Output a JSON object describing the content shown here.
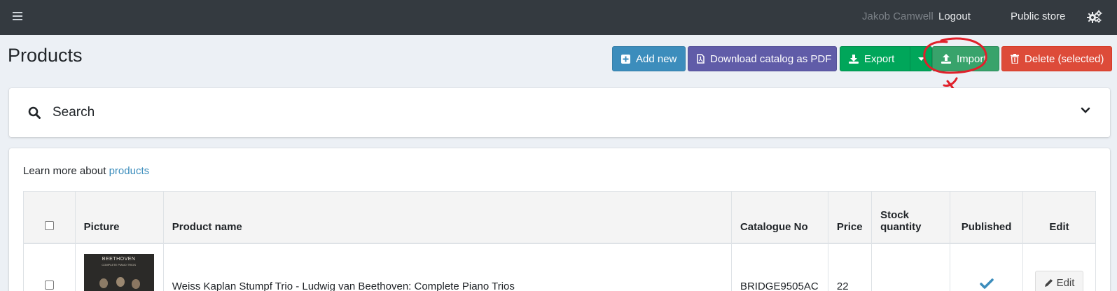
{
  "navbar": {
    "menu_icon": "hamburger-icon",
    "user_name": "Jakob Camwell",
    "logout_label": "Logout",
    "public_store_label": "Public store",
    "settings_icon": "gears-icon"
  },
  "page": {
    "title": "Products"
  },
  "toolbar": {
    "add_new_label": "Add new",
    "download_pdf_label": "Download catalog as PDF",
    "export_label": "Export",
    "import_label": "Import",
    "delete_label": "Delete (selected)",
    "colors": {
      "add_new": "#3c8dbc",
      "download_pdf": "#605ca8",
      "export": "#00a65a",
      "import": "#38a36b",
      "delete": "#dd4b39",
      "annotation": "#e0202a"
    }
  },
  "search": {
    "label": "Search",
    "icon": "search-icon",
    "toggle_icon": "chevron-down-icon"
  },
  "info": {
    "learn_prefix": "Learn more about",
    "learn_link": "products"
  },
  "table": {
    "columns": [
      "",
      "Picture",
      "Product name",
      "Catalogue No",
      "Price",
      "Stock quantity",
      "Published",
      "Edit"
    ],
    "rows": [
      {
        "picture_title": "BEETHOVEN",
        "picture_subtitle": "COMPLETE PIANO TRIOS",
        "product_name": "Weiss Kaplan Stumpf Trio - Ludwig van Beethoven: Complete Piano Trios",
        "catalogue_no": "BRIDGE9505AC",
        "price": "22",
        "stock_quantity": "",
        "published": true,
        "edit_label": "Edit"
      }
    ]
  }
}
